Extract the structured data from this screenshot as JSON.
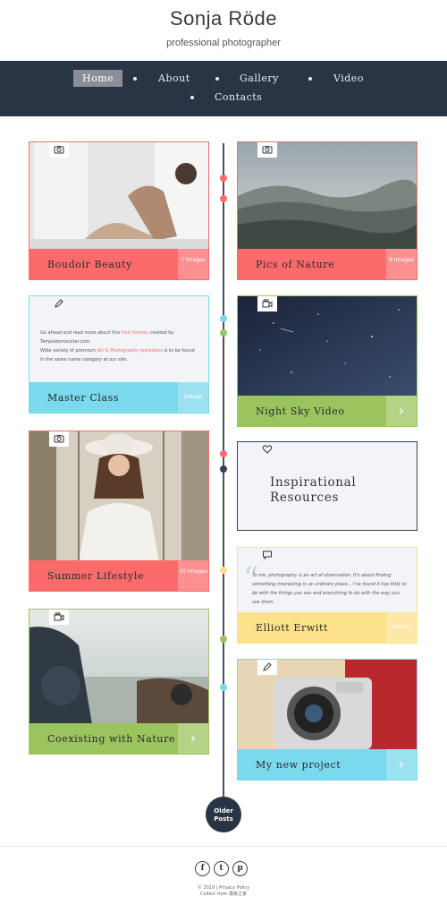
{
  "header": {
    "title": "Sonja Röde",
    "subtitle": "professional photographer"
  },
  "nav": {
    "items": [
      "Home",
      "About",
      "Gallery",
      "Video",
      "Contacts"
    ],
    "active": "Home"
  },
  "cards": [
    {
      "title": "Boudoir Beauty",
      "count": "7 Images",
      "icon": "camera-icon",
      "color": "#fb6b6b"
    },
    {
      "title": "Pics of Nature",
      "count": "8 Images",
      "icon": "camera-icon",
      "color": "#fb6b6b"
    },
    {
      "title": "Master Class",
      "count": "Details",
      "icon": "pencil-icon",
      "color": "#7ad9ed",
      "text": [
        "Go ahead and read more about this ",
        "free themes",
        " created by",
        "Templatemonster.com.",
        "Wide variety of premium ",
        "Art & Photography templates",
        " is to be found",
        "in the same name category at our site."
      ]
    },
    {
      "title": "Night Sky Video",
      "icon": "video-camera-icon",
      "color": "#9bc45f"
    },
    {
      "title": "Summer Lifestyle",
      "count": "10 Images",
      "icon": "camera-icon",
      "color": "#fb6b6b"
    },
    {
      "title": "Inspirational Resources",
      "icon": "heart-icon",
      "color": "#34405a"
    },
    {
      "title": "Coexisting with Nature",
      "icon": "video-camera-icon",
      "color": "#9bc45f"
    },
    {
      "title": "Elliott Erwitt",
      "count": "Details",
      "icon": "chat-bubble-icon",
      "color": "#fde18a",
      "text": "To me, photography is an art of observation. It's about finding something interesting in an ordinary place... I've found it has little to do with the things you see and everything to do with the way you see them."
    },
    {
      "title": "My new project",
      "icon": "pencil-icon",
      "color": "#7ad9ed"
    }
  ],
  "older_posts": "Older Posts",
  "footer": {
    "social": [
      "f",
      "t",
      "p"
    ],
    "copyright": "© 2019 | Privacy Policy",
    "collect": "Collect from 模板之家"
  }
}
